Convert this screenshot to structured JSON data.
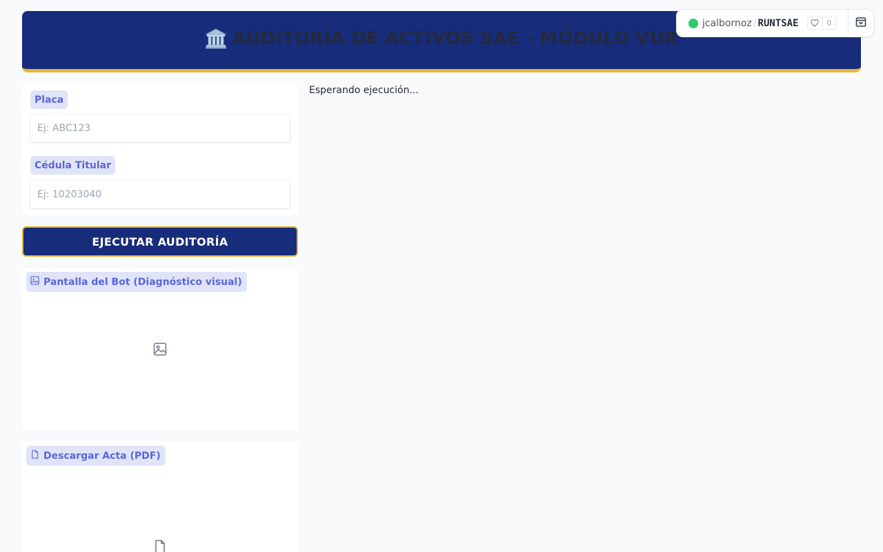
{
  "header": {
    "title": "AUDITORÍA DE ACTIVOS SAE - MÓDULO VUR",
    "icon": "bank-icon"
  },
  "space_badge": {
    "user": "jcalbornoz",
    "separator": "/",
    "space": "RUNTSAE",
    "likes": "0",
    "status_color": "#31c969"
  },
  "form": {
    "placa": {
      "label": "Placa",
      "placeholder": "Ej: ABC123",
      "value": ""
    },
    "cedula": {
      "label": "Cédula Titular",
      "placeholder": "Ej: 10203040",
      "value": ""
    }
  },
  "actions": {
    "execute_label": "EJECUTAR AUDITORÍA"
  },
  "image_panel": {
    "label": "Pantalla del Bot (Diagnóstico visual)",
    "icon": "image-icon"
  },
  "file_panel": {
    "label": "Descargar Acta (PDF)",
    "icon": "file-icon"
  },
  "output": {
    "status": "Esperando ejecución..."
  },
  "colors": {
    "brand_navy": "#172c7a",
    "accent_gold": "#e7b431",
    "label_bg": "#e0e4f8",
    "label_text": "#5b67d6"
  }
}
